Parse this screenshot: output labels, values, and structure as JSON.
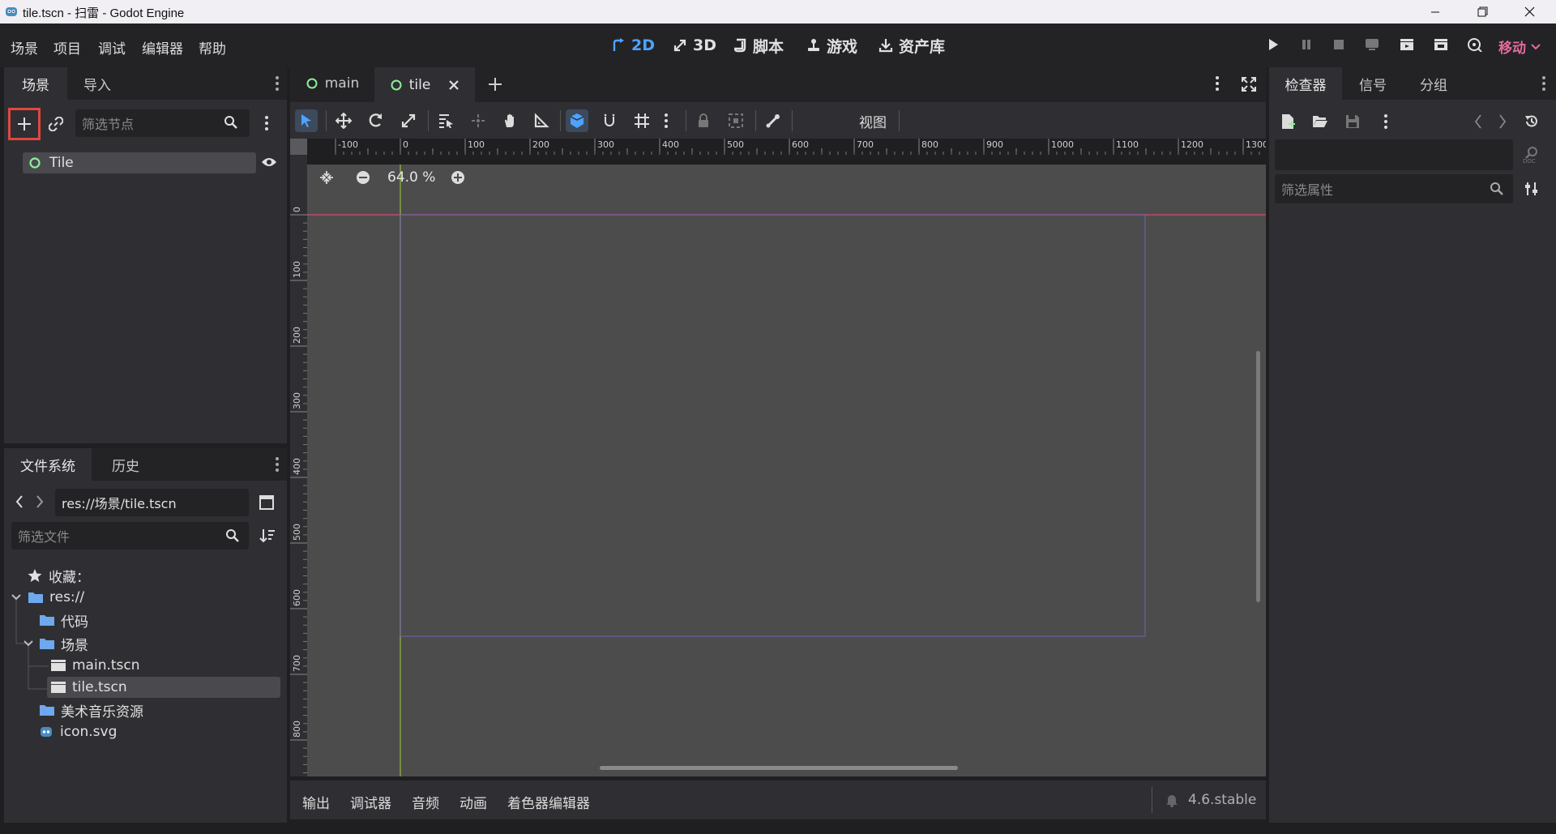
{
  "window": {
    "title": "tile.tscn - 扫雷 - Godot Engine"
  },
  "menu": {
    "items": [
      "场景",
      "项目",
      "调试",
      "编辑器",
      "帮助"
    ]
  },
  "main_screens": [
    {
      "label": "2D",
      "active": true
    },
    {
      "label": "3D",
      "active": false
    },
    {
      "label": "脚本",
      "active": false
    },
    {
      "label": "游戏",
      "active": false
    },
    {
      "label": "资产库",
      "active": false
    }
  ],
  "renderer": {
    "label": "移动"
  },
  "scene_dock": {
    "tabs": [
      "场景",
      "导入"
    ],
    "filter_placeholder": "筛选节点",
    "root_node": "Tile"
  },
  "filesystem_dock": {
    "tabs": [
      "文件系统",
      "历史"
    ],
    "path": "res://场景/tile.tscn",
    "filter_placeholder": "筛选文件",
    "favorites_label": "收藏：",
    "items": {
      "res": "res://",
      "code": "代码",
      "scenes": "场景",
      "main": "main.tscn",
      "tile": "tile.tscn",
      "art": "美术音乐资源",
      "icon": "icon.svg"
    }
  },
  "editor_tabs": [
    {
      "label": "main",
      "active": false
    },
    {
      "label": "tile",
      "active": true
    }
  ],
  "toolbar2d": {
    "view_label": "视图"
  },
  "viewport": {
    "zoom_label": "64.0 %",
    "ruler_h": [
      "-100",
      "0",
      "100",
      "200",
      "300",
      "400",
      "500",
      "600",
      "700",
      "800",
      "900",
      "1000",
      "1100",
      "1200",
      "1300"
    ],
    "ruler_v": [
      "0",
      "100",
      "200",
      "300",
      "400",
      "500",
      "600",
      "700",
      "800"
    ]
  },
  "bottom_panel": {
    "tabs": [
      "输出",
      "调试器",
      "音频",
      "动画",
      "着色器编辑器"
    ],
    "version": "4.6.stable"
  },
  "inspector": {
    "tabs": [
      "检查器",
      "信号",
      "分组"
    ],
    "filter_placeholder": "筛选属性"
  },
  "colors": {
    "accent": "#4ea3ff",
    "renderer": "#e36b9e",
    "highlight_box": "#e0463f",
    "node_ring": "#8eef97",
    "folder": "#6ea8ee"
  }
}
